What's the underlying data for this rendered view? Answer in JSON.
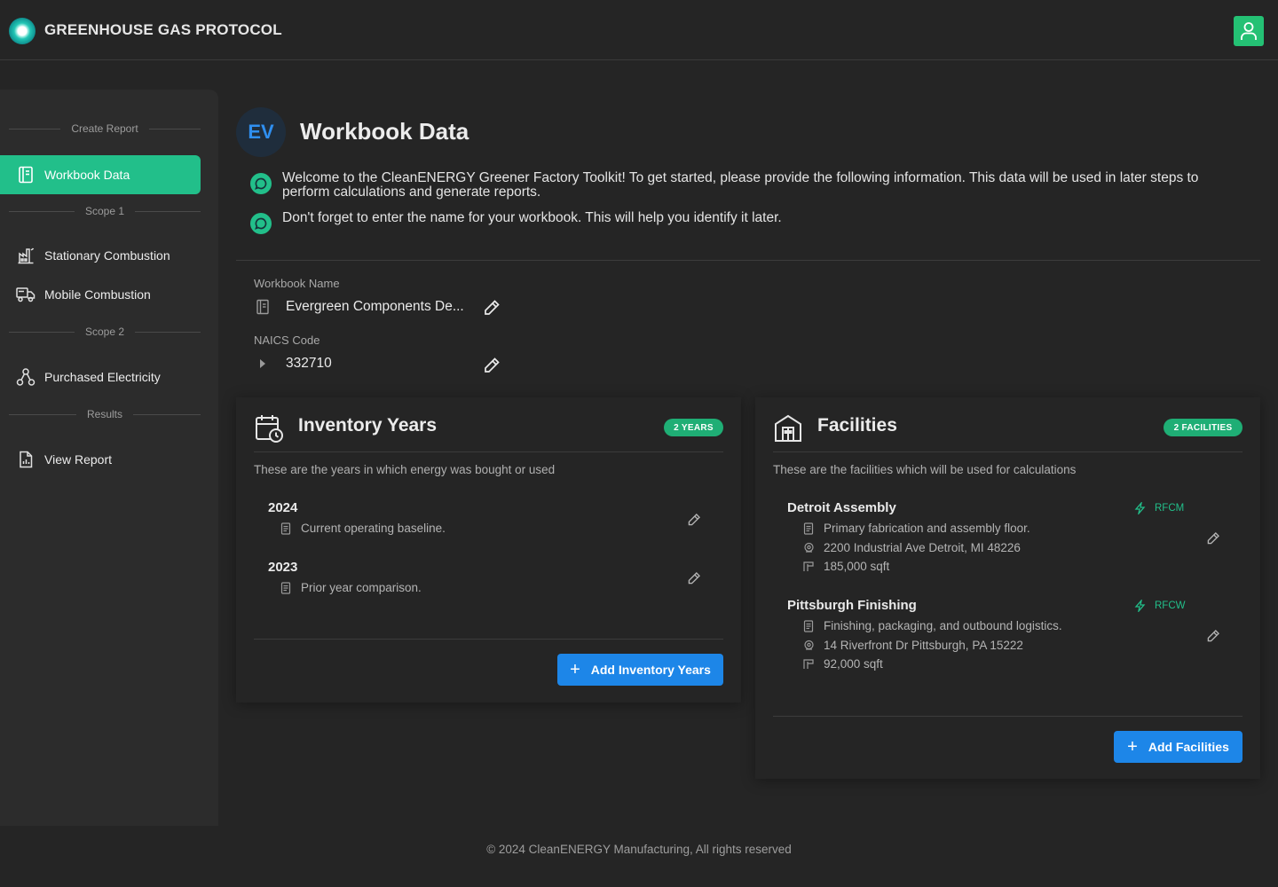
{
  "header": {
    "title": "GREENHOUSE GAS PROTOCOL"
  },
  "sidebar": {
    "sections": [
      "Create Report",
      "Scope 1",
      "Scope 2",
      "Results"
    ],
    "items": [
      {
        "label": "Workbook Data",
        "icon": "book-icon",
        "active": true
      },
      {
        "label": "Stationary Combustion",
        "icon": "factory-icon"
      },
      {
        "label": "Mobile Combustion",
        "icon": "truck-icon"
      },
      {
        "label": "Purchased Electricity",
        "icon": "network-icon"
      },
      {
        "label": "View Report",
        "icon": "report-icon"
      }
    ]
  },
  "main": {
    "avatar": "EV",
    "title": "Workbook Data",
    "notices": [
      "Welcome to the CleanENERGY Greener Factory Toolkit! To get started, please provide the following information. This data will be used in later steps to perform calculations and generate reports.",
      "Don't forget to enter the name for your workbook. This will help you identify it later."
    ],
    "workbook_name": {
      "label": "Workbook Name",
      "value": "Evergreen Components De..."
    },
    "naics": {
      "label": "NAICS Code",
      "value": "332710"
    }
  },
  "inventory": {
    "title": "Inventory Years",
    "badge": "2 YEARS",
    "description": "These are the years in which energy was bought or used",
    "years": [
      {
        "year": "2024",
        "note": "Current operating baseline."
      },
      {
        "year": "2023",
        "note": "Prior year comparison."
      }
    ],
    "add_label": "Add Inventory Years"
  },
  "facilities": {
    "title": "Facilities",
    "badge": "2 FACILITIES",
    "description": "These are the facilities which will be used for calculations",
    "items": [
      {
        "name": "Detroit Assembly",
        "region": "RFCM",
        "description": "Primary fabrication and assembly floor.",
        "address": "2200 Industrial Ave Detroit, MI 48226",
        "area": "185,000 sqft"
      },
      {
        "name": "Pittsburgh Finishing",
        "region": "RFCW",
        "description": "Finishing, packaging, and outbound logistics.",
        "address": "14 Riverfront Dr Pittsburgh, PA 15222",
        "area": "92,000 sqft"
      }
    ],
    "add_label": "Add Facilities"
  },
  "footer": {
    "text": "© 2024 CleanENERGY Manufacturing, All rights reserved"
  },
  "colors": {
    "accent": "#22bf8a",
    "primary": "#1d86e8",
    "background": "#252525"
  }
}
